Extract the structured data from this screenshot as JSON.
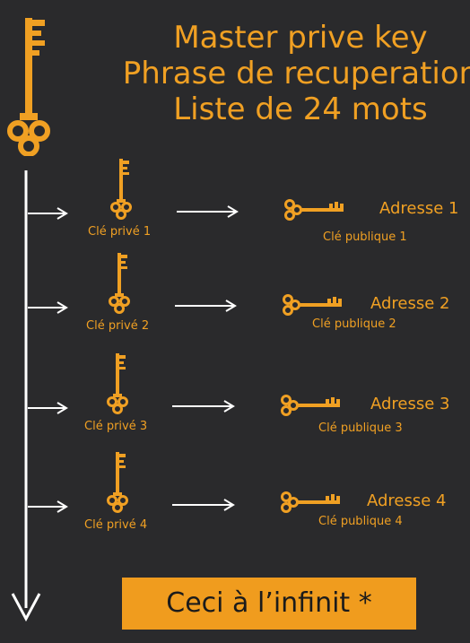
{
  "title_lines": [
    "Master prive key",
    "Phrase de recuperation",
    "Liste de 24 mots"
  ],
  "rows": [
    {
      "private_label": "Clé privé 1",
      "address_label": "Adresse 1",
      "public_label": "Clé publique 1"
    },
    {
      "private_label": "Clé privé 2",
      "address_label": "Adresse 2",
      "public_label": "Clé publique 2"
    },
    {
      "private_label": "Clé privé 3",
      "address_label": "Adresse 3",
      "public_label": "Clé publique 3"
    },
    {
      "private_label": "Clé privé 4",
      "address_label": "Adresse 4",
      "public_label": "Clé publique 4"
    }
  ],
  "cta_label": "Ceci à l’infinit *",
  "colors": {
    "background": "#2a2a2c",
    "accent": "#f0a023",
    "arrow": "#ffffff"
  },
  "icons": {
    "master": "master-key-icon",
    "private": "private-key-icon",
    "public": "public-key-icon"
  }
}
